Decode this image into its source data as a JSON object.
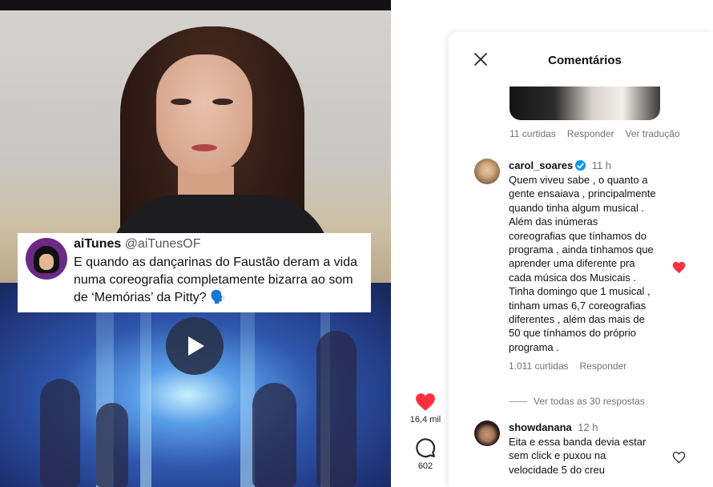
{
  "post": {
    "tweet": {
      "name": "aiTunes",
      "handle": "@aiTunesOF",
      "text": "E quando as dançarinas do Faustão deram a vida numa coreografia completamente bizarra ao som de ‘Memórias’ da Pitty? 🗣️"
    },
    "likes": "16,4 mil",
    "comments_count": "602"
  },
  "comments_panel": {
    "title": "Comentários",
    "previous_comment": {
      "likes": "11 curtidas",
      "reply": "Responder",
      "translate": "Ver tradução"
    },
    "comments": [
      {
        "user": "carol_soares",
        "verified": true,
        "time": "11 h",
        "lines": [
          "Quem viveu sabe , o quanto a",
          "gente ensaiava , principalmente",
          "quando tinha algum musical .",
          "Além das inúmeras",
          "coreografias que tínhamos do",
          "programa , ainda tínhamos que",
          "aprender uma diferente pra",
          "cada música dos Musicais .",
          "Tinha domingo que 1 musical ,",
          "tinham umas 6,7 coreografias",
          "diferentes , além das mais de",
          "50 que tínhamos do próprio",
          "programa ."
        ],
        "likes": "1.011 curtidas",
        "reply": "Responder",
        "liked": true
      },
      {
        "user": "showdanana",
        "verified": false,
        "time": "12 h",
        "lines": [
          "Eita e essa banda devia estar",
          "sem click e puxou na",
          "velocidade 5 do creu"
        ],
        "liked": false
      }
    ],
    "view_all_replies": "Ver todas as 30 respostas"
  },
  "colors": {
    "like_red": "#ff3040",
    "verified_blue": "#0095f6",
    "muted_text": "#737373"
  }
}
